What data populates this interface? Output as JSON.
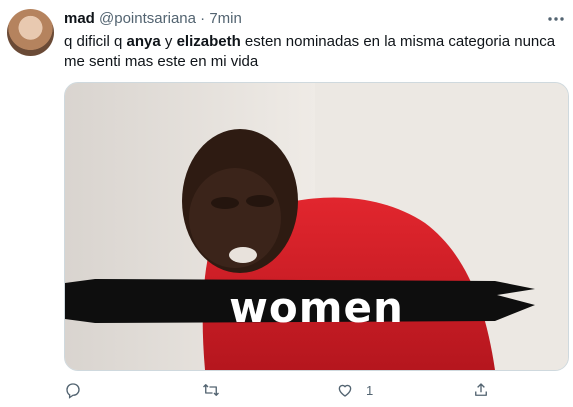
{
  "tweet": {
    "author_name": "mad",
    "author_handle": "@pointsariana",
    "separator": "·",
    "time": "7min",
    "text_parts": [
      "q dificil q ",
      "anya",
      " y ",
      "elizabeth",
      " esten nominadas en la misma categoria nunca me senti mas este en mi vida"
    ],
    "media_caption": "women",
    "actions": {
      "reply_count": "",
      "retweet_count": "",
      "like_count": "1",
      "share_count": ""
    }
  },
  "icons": [
    "more-icon",
    "reply-icon",
    "retweet-icon",
    "like-icon",
    "share-icon"
  ],
  "colors": {
    "text_primary": "#0f1419",
    "text_secondary": "#536471",
    "media_border": "#cfd9de"
  }
}
